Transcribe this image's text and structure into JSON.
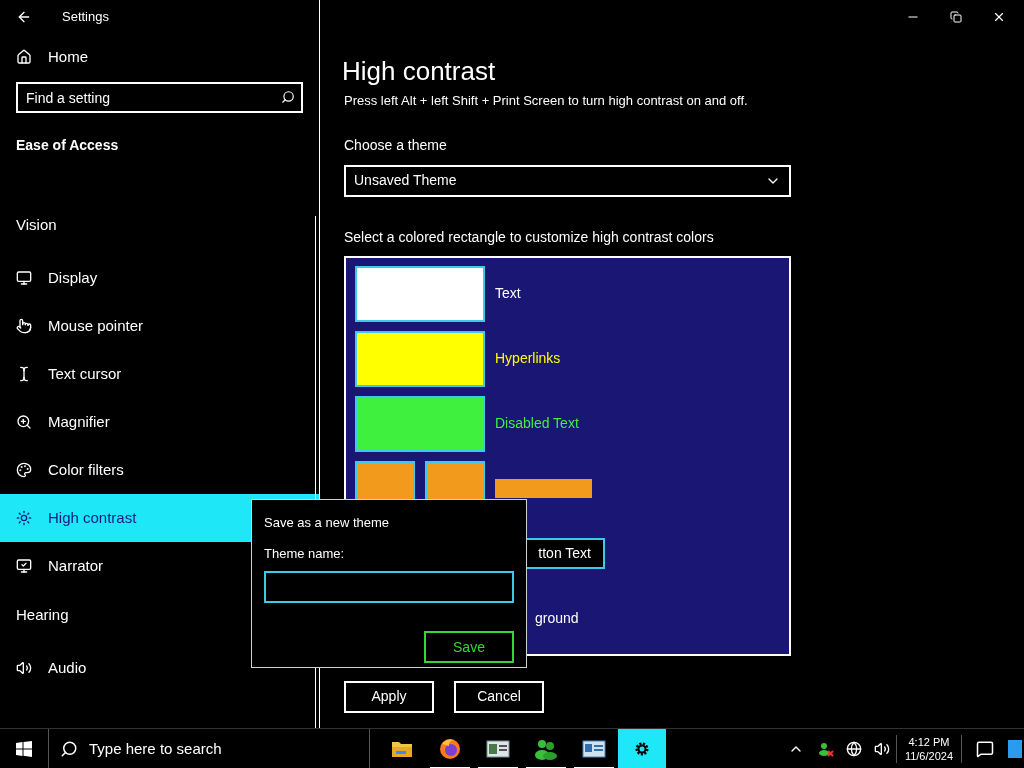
{
  "window": {
    "title": "Settings"
  },
  "sidebar": {
    "home": "Home",
    "search": {
      "placeholder": "Find a setting"
    },
    "category": "Ease of Access",
    "groups": [
      {
        "heading": "Vision",
        "items": [
          {
            "label": "Display",
            "kind": "display",
            "selected": false
          },
          {
            "label": "Mouse pointer",
            "kind": "pointer",
            "selected": false
          },
          {
            "label": "Text cursor",
            "kind": "cursor",
            "selected": false
          },
          {
            "label": "Magnifier",
            "kind": "magnifier",
            "selected": false
          },
          {
            "label": "Color filters",
            "kind": "palette",
            "selected": false
          },
          {
            "label": "High contrast",
            "kind": "sun",
            "selected": true
          },
          {
            "label": "Narrator",
            "kind": "narrator",
            "selected": false
          }
        ]
      },
      {
        "heading": "Hearing",
        "items": [
          {
            "label": "Audio",
            "kind": "audio",
            "selected": false
          }
        ]
      }
    ]
  },
  "main": {
    "title": "High contrast",
    "description": "Press left Alt + left Shift + Print Screen to turn high contrast on and off.",
    "theme": {
      "label": "Choose a theme",
      "value": "Unsaved Theme"
    },
    "colors_label": "Select a colored rectangle to customize high contrast colors",
    "colors": [
      {
        "kind": "swatch",
        "label": "Text",
        "color": "#ffffff"
      },
      {
        "kind": "swatch",
        "label": "Hyperlinks",
        "color": "#ffff00"
      },
      {
        "kind": "swatch",
        "label": "Disabled Text",
        "color": "#3ff03f"
      },
      {
        "kind": "pair",
        "color": "#f29a1c"
      },
      {
        "kind": "button",
        "label": "tton Text"
      },
      {
        "kind": "plain",
        "label": "ground"
      }
    ],
    "buttons": [
      "Apply",
      "Cancel"
    ]
  },
  "dialog": {
    "title": "Save as a new theme",
    "field_label": "Theme name:",
    "button": "Save"
  },
  "taskbar": {
    "search": {
      "placeholder": "Type here to search"
    },
    "apps": [
      {
        "kind": "folder",
        "selected": false,
        "open": false
      },
      {
        "kind": "browser",
        "selected": false,
        "open": true
      },
      {
        "kind": "window",
        "selected": false,
        "open": true
      },
      {
        "kind": "people",
        "selected": false,
        "open": true
      },
      {
        "kind": "card",
        "selected": false,
        "open": true
      },
      {
        "kind": "gear",
        "selected": true,
        "open": true
      }
    ],
    "time": "4:12 PM",
    "date": "11/6/2024"
  }
}
